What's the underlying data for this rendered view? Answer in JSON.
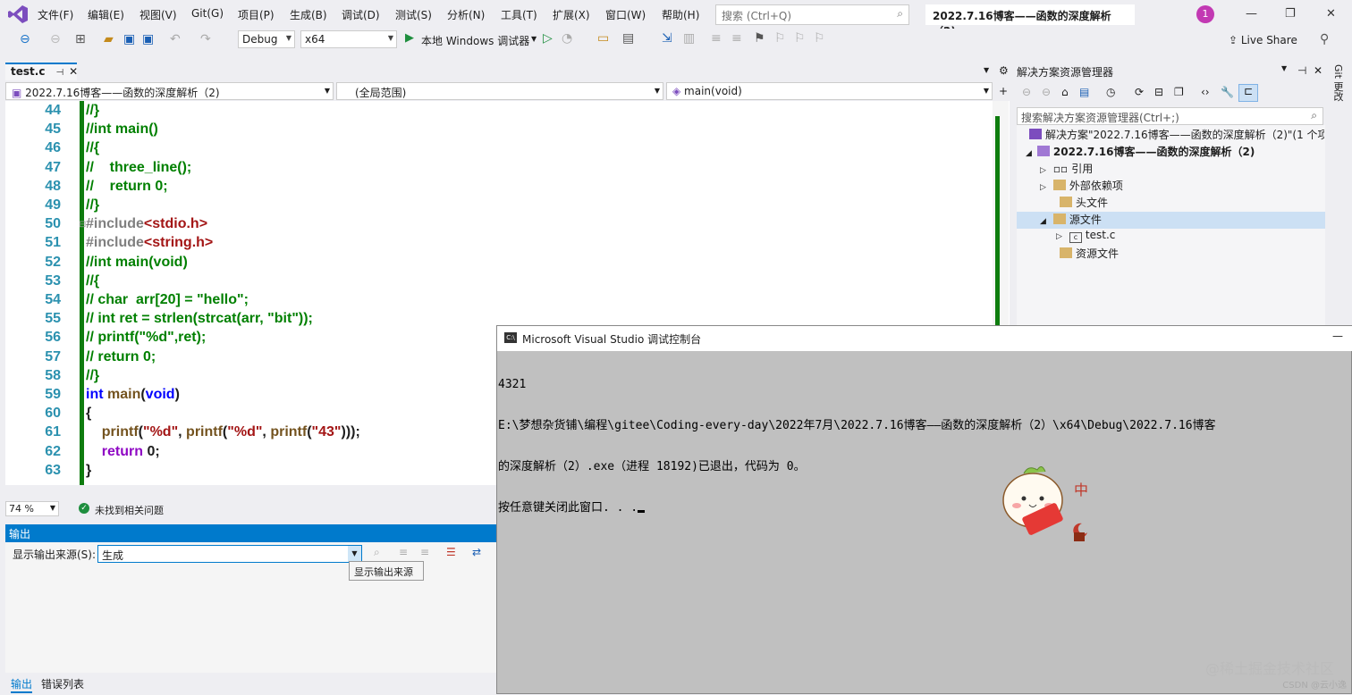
{
  "menubar": {
    "items": [
      "文件(F)",
      "编辑(E)",
      "视图(V)",
      "Git(G)",
      "项目(P)",
      "生成(B)",
      "调试(D)",
      "测试(S)",
      "分析(N)",
      "工具(T)",
      "扩展(X)",
      "窗口(W)",
      "帮助(H)"
    ],
    "search_placeholder": "搜索 (Ctrl+Q)",
    "window_title": "2022.7.16博客——函数的深度解析（2)",
    "notification_count": "1"
  },
  "toolbar": {
    "config": "Debug",
    "platform": "x64",
    "run_label": "本地 Windows 调试器",
    "live_share": "Live Share"
  },
  "tabs": {
    "active": "test.c"
  },
  "navbar": {
    "project": "2022.7.16博客——函数的深度解析（2)",
    "scope": "(全局范围)",
    "function": "main(void)"
  },
  "editor": {
    "lines": [
      {
        "n": "44",
        "t": "//}"
      },
      {
        "n": "45",
        "t": "//int main()"
      },
      {
        "n": "46",
        "t": "//{"
      },
      {
        "n": "47",
        "t": "//    three_line();"
      },
      {
        "n": "48",
        "t": "//    return 0;"
      },
      {
        "n": "49",
        "t": "//}"
      },
      {
        "n": "50",
        "t": "#include<stdio.h>"
      },
      {
        "n": "51",
        "t": "#include<string.h>"
      },
      {
        "n": "52",
        "t": "//int main(void)"
      },
      {
        "n": "53",
        "t": "//{"
      },
      {
        "n": "54",
        "t": "// char  arr[20] = \"hello\";"
      },
      {
        "n": "55",
        "t": "// int ret = strlen(strcat(arr, \"bit\"));"
      },
      {
        "n": "56",
        "t": "// printf(\"%d\",ret);"
      },
      {
        "n": "57",
        "t": "// return 0;"
      },
      {
        "n": "58",
        "t": "//}"
      },
      {
        "n": "59",
        "t": "int main(void)"
      },
      {
        "n": "60",
        "t": "{"
      },
      {
        "n": "61",
        "t": "    printf(\"%d\", printf(\"%d\", printf(\"43\")));"
      },
      {
        "n": "62",
        "t": "    return 0;"
      },
      {
        "n": "63",
        "t": "}"
      }
    ]
  },
  "status": {
    "zoom": "74 %",
    "issues": "未找到相关问题"
  },
  "output": {
    "title": "输出",
    "source_label": "显示输出来源(S):",
    "source_value": "生成",
    "tooltip": "显示输出来源",
    "tab_output": "输出",
    "tab_errors": "错误列表"
  },
  "solution": {
    "title": "解决方案资源管理器",
    "search_placeholder": "搜索解决方案资源管理器(Ctrl+;)",
    "root": "解决方案\"2022.7.16博客——函数的深度解析（2)\"(1 个项",
    "project": "2022.7.16博客——函数的深度解析（2)",
    "items": [
      "引用",
      "外部依赖项",
      "头文件",
      "源文件",
      "test.c",
      "资源文件"
    ]
  },
  "git_strip": "Git 更改",
  "console": {
    "title": "Microsoft Visual Studio 调试控制台",
    "lines": [
      "4321",
      "E:\\梦想杂货铺\\编程\\gitee\\Coding-every-day\\2022年7月\\2022.7.16博客——函数的深度解析（2）\\x64\\Debug\\2022.7.16博客",
      "的深度解析（2）.exe（进程 18192)已退出，代码为 0。",
      "按任意键关闭此窗口. . ."
    ],
    "sticker_text": "中"
  },
  "watermark": "@稀土掘金技术社区",
  "watermark_small": "CSDN @云小逸"
}
